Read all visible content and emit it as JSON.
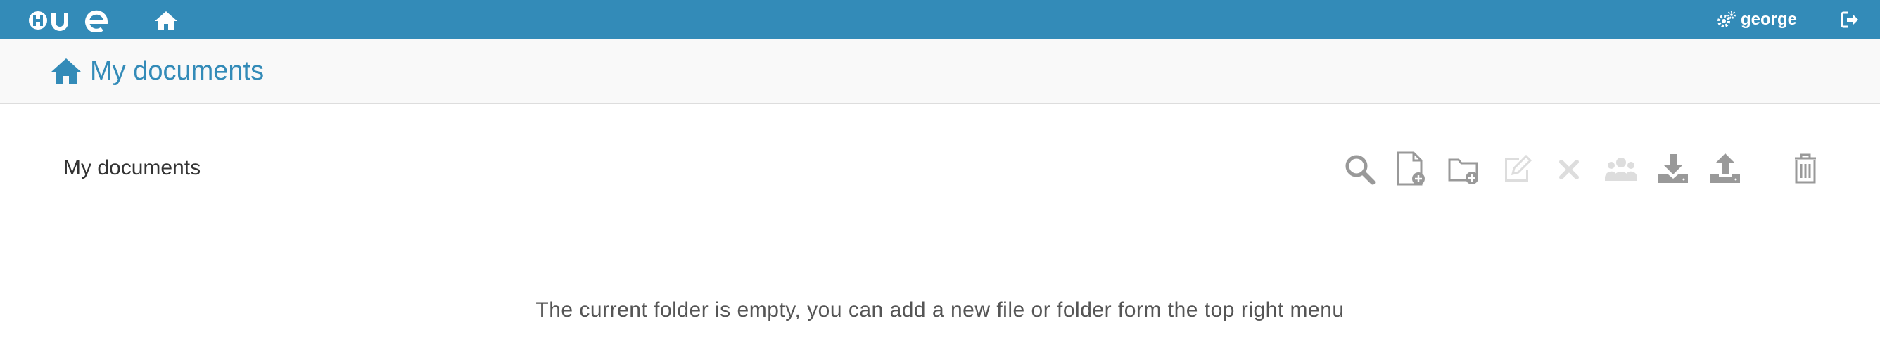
{
  "topbar": {
    "logo_icon": "hue-logo",
    "home_icon": "home-icon",
    "user": {
      "icon": "cogs-icon",
      "name": "george"
    },
    "logout_icon": "sign-out-icon",
    "color": "#338bb8"
  },
  "header": {
    "title": "My documents",
    "icon": "home-icon"
  },
  "breadcrumb": {
    "current": "My documents"
  },
  "toolbar": {
    "buttons": [
      {
        "name": "search",
        "icon": "search-icon",
        "enabled": true
      },
      {
        "name": "new-document",
        "icon": "file-plus-icon",
        "enabled": true
      },
      {
        "name": "new-folder",
        "icon": "folder-plus-icon",
        "enabled": true
      },
      {
        "name": "edit",
        "icon": "pencil-icon",
        "enabled": false
      },
      {
        "name": "delete",
        "icon": "times-icon",
        "enabled": false
      },
      {
        "name": "share",
        "icon": "users-icon",
        "enabled": false
      },
      {
        "name": "download",
        "icon": "download-icon",
        "enabled": true
      },
      {
        "name": "upload",
        "icon": "upload-icon",
        "enabled": true
      },
      {
        "name": "trash",
        "icon": "trash-icon",
        "enabled": true
      }
    ],
    "enabled_color": "#999999",
    "disabled_color": "#dddddd"
  },
  "empty_message": "The current folder is empty, you can add a new file or folder form the top right menu"
}
